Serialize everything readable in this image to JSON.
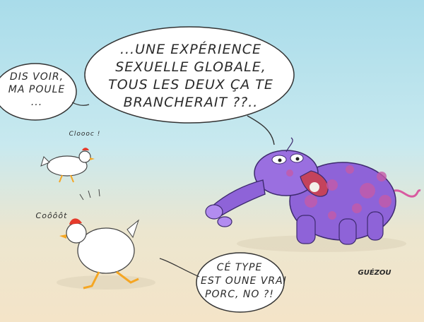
{
  "speech": {
    "main": [
      "...UNE EXPÉRIENCE",
      "SEXUELLE GLOBALE,",
      "TOUS LES DEUX ÇA TE",
      "BRANCHERAIT ??.."
    ],
    "left": [
      "DIS VOIR,",
      "MA POULE",
      "..."
    ],
    "right": [
      "CÉ TYPE",
      "EST OUNE VRAI",
      "PORC, NO ?!"
    ]
  },
  "sound_effects": {
    "hen_top": "Cloooc !",
    "hen_bottom": "Coôôôt"
  },
  "signature": "GUÉZOU",
  "colors": {
    "sky": "#a9dcea",
    "ground": "#f4e4c8",
    "pig_body": "#8e63d8",
    "pig_spots": "#c45aa8",
    "comb": "#e53a2b",
    "beak_feet": "#f5a623"
  }
}
